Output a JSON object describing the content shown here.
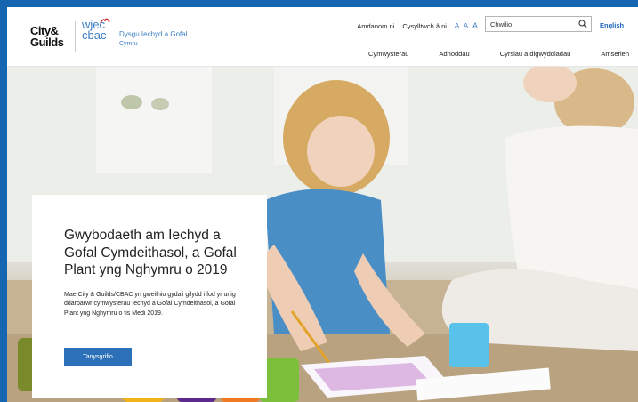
{
  "brand": {
    "logo_city_guilds_line1": "City&",
    "logo_city_guilds_line2": "Guilds",
    "logo_wjec_line1": "wjec",
    "logo_wjec_line2": "cbac",
    "site_name": "Dysgu Iechyd a Gofal",
    "site_sub": "Cymru"
  },
  "utility": {
    "about": "Amdanom ni",
    "contact": "Cysylltwch â ni",
    "text_size": [
      "A",
      "A",
      "A"
    ]
  },
  "search": {
    "placeholder": "Chwilio"
  },
  "language": "English",
  "nav": [
    "Cymwysterau",
    "Adnoddau",
    "Cyrsiau a digwyddiadau",
    "Amserlen"
  ],
  "hero": {
    "title": "Gwybodaeth am Iechyd a Gofal Cymdeithasol, a Gofal Plant yng Nghymru o 2019",
    "body": "Mae City & Guilds/CBAC yn gweithio gyda'i gilydd i fod yr unig ddarparwr cymwysterau Iechyd a Gofal Cymdeithasol, a Gofal Plant yng Nghymru o fis Medi 2019.",
    "cta": "Tanysgrifio"
  },
  "colors": {
    "accent": "#2b70b8",
    "frame": "#1565b0",
    "logo_red": "#d0202e"
  }
}
